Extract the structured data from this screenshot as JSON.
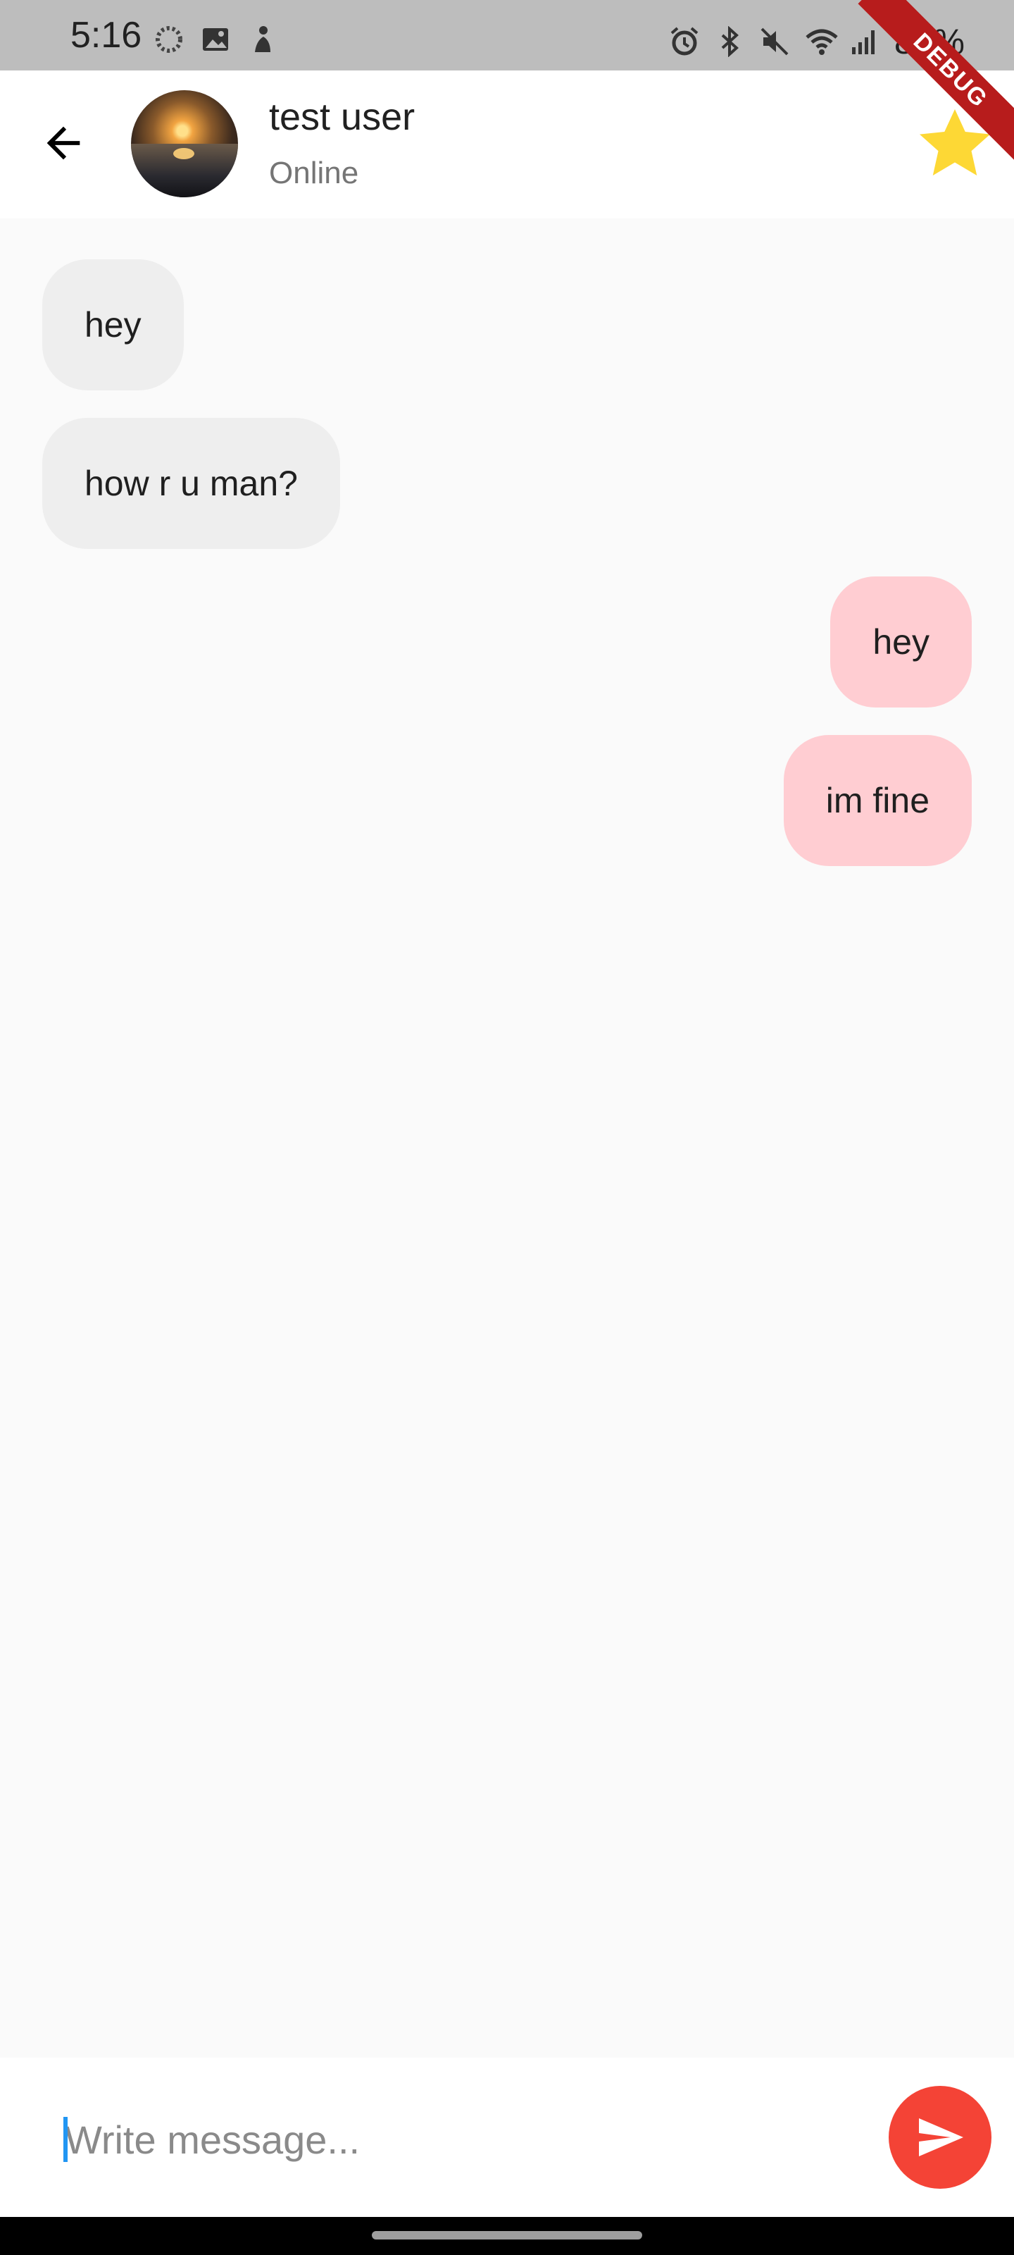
{
  "status_bar": {
    "time": "5:16",
    "battery": "84%",
    "left_icons": [
      "loading-icon",
      "image-icon",
      "figure-icon"
    ],
    "right_icons": [
      "alarm-icon",
      "bluetooth-icon",
      "mute-icon",
      "wifi-icon",
      "signal-icon"
    ]
  },
  "debug_banner": "DEBUG",
  "header": {
    "contact_name": "test user",
    "contact_status": "Online",
    "back_icon": "arrow-back-icon",
    "favorite_icon": "star-icon",
    "star_color": "#fdd835"
  },
  "messages": [
    {
      "direction": "incoming",
      "text": "hey"
    },
    {
      "direction": "incoming",
      "text": "how r u man?"
    },
    {
      "direction": "outgoing",
      "text": "hey"
    },
    {
      "direction": "outgoing",
      "text": "im fine"
    }
  ],
  "composer": {
    "placeholder": "Write message...",
    "value": "",
    "send_icon": "send-icon",
    "send_color": "#f44336"
  },
  "colors": {
    "incoming_bubble": "#eeeeee",
    "outgoing_bubble": "#ffcdd2",
    "background": "#fafafa"
  }
}
